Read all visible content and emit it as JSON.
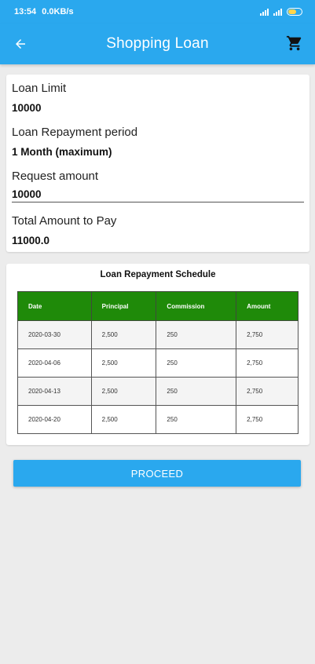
{
  "status_bar": {
    "time": "13:54",
    "speed": "0.0KB/s"
  },
  "app_bar": {
    "title": "Shopping Loan",
    "back_icon": "arrow-left-icon",
    "cart_icon": "shopping-cart-icon"
  },
  "form": {
    "loan_limit_label": "Loan Limit",
    "loan_limit_value": "10000",
    "repayment_period_label": "Loan Repayment period",
    "repayment_period_value": "1 Month (maximum)",
    "request_amount_label": "Request amount",
    "request_amount_value": "10000",
    "total_label": "Total Amount to Pay",
    "total_value": "11000.0"
  },
  "schedule": {
    "title": "Loan Repayment Schedule",
    "headers": [
      "Date",
      "Principal",
      "Commission",
      "Amount"
    ],
    "rows": [
      [
        "2020-03-30",
        "2,500",
        "250",
        "2,750"
      ],
      [
        "2020-04-06",
        "2,500",
        "250",
        "2,750"
      ],
      [
        "2020-04-13",
        "2,500",
        "250",
        "2,750"
      ],
      [
        "2020-04-20",
        "2,500",
        "250",
        "2,750"
      ]
    ]
  },
  "actions": {
    "proceed_label": "PROCEED"
  },
  "colors": {
    "primary": "#2aa8ee",
    "table_header": "#1f8a09",
    "background": "#ececec"
  }
}
